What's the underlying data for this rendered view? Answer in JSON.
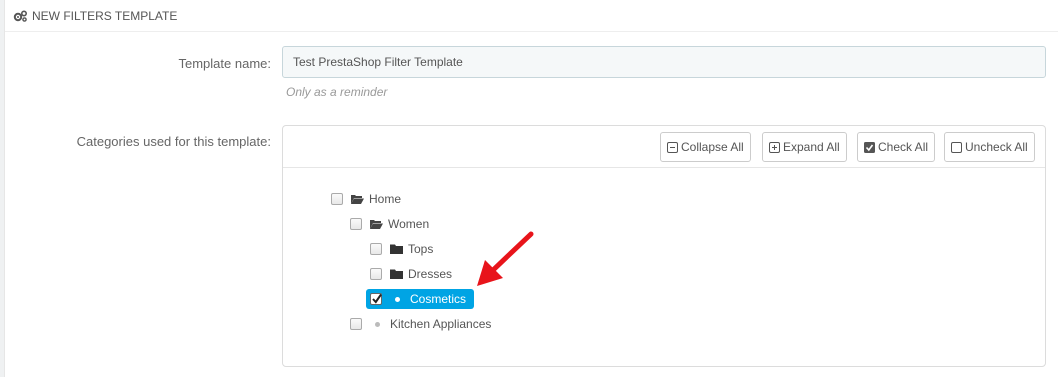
{
  "panel": {
    "title": "NEW FILTERS TEMPLATE",
    "icon": "gears-icon"
  },
  "form": {
    "template_name_label": "Template name:",
    "template_name_value": "Test PrestaShop Filter Template",
    "template_name_help": "Only as a reminder",
    "categories_label": "Categories used for this template:"
  },
  "toolbar": {
    "collapse_all": "Collapse All",
    "expand_all": "Expand All",
    "check_all": "Check All",
    "uncheck_all": "Uncheck All"
  },
  "tree": {
    "home": "Home",
    "women": "Women",
    "tops": "Tops",
    "dresses": "Dresses",
    "cosmetics": "Cosmetics",
    "kitchen": "Kitchen Appliances"
  },
  "colors": {
    "selected": "#00a4e4",
    "arrow": "#e8141b"
  }
}
